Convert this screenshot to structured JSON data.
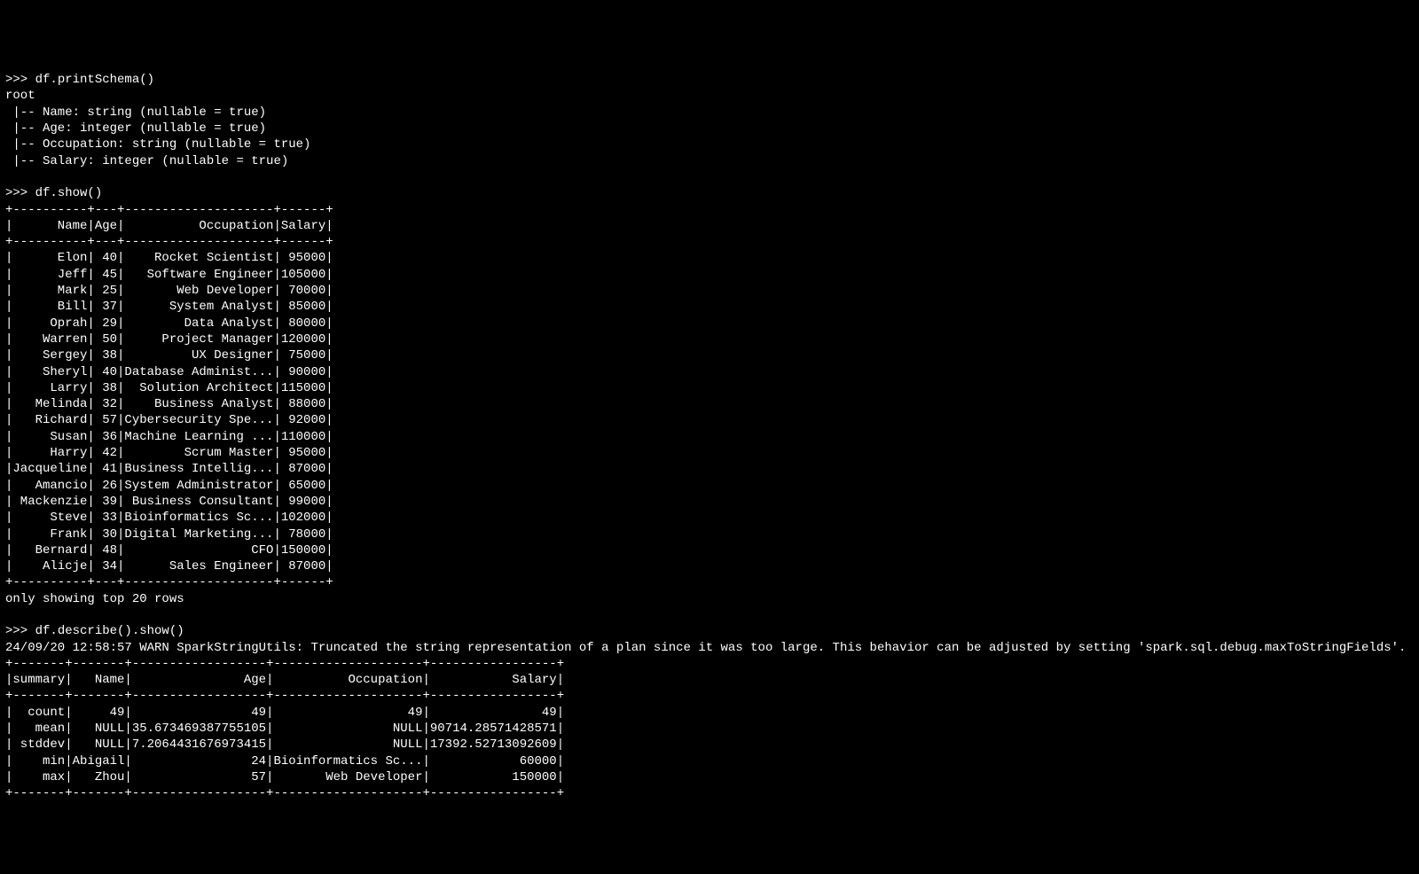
{
  "prompt": ">>> ",
  "commands": {
    "printSchema": "df.printSchema()",
    "show": "df.show()",
    "describe": "df.describe().show()"
  },
  "schema": {
    "root": "root",
    "fields": [
      " |-- Name: string (nullable = true)",
      " |-- Age: integer (nullable = true)",
      " |-- Occupation: string (nullable = true)",
      " |-- Salary: integer (nullable = true)"
    ]
  },
  "showTable": {
    "sep": "+----------+---+--------------------+------+",
    "header": "|      Name|Age|          Occupation|Salary|",
    "rows": [
      "|      Elon| 40|    Rocket Scientist| 95000|",
      "|      Jeff| 45|   Software Engineer|105000|",
      "|      Mark| 25|       Web Developer| 70000|",
      "|      Bill| 37|      System Analyst| 85000|",
      "|     Oprah| 29|        Data Analyst| 80000|",
      "|    Warren| 50|     Project Manager|120000|",
      "|    Sergey| 38|         UX Designer| 75000|",
      "|    Sheryl| 40|Database Administ...| 90000|",
      "|     Larry| 38|  Solution Architect|115000|",
      "|   Melinda| 32|    Business Analyst| 88000|",
      "|   Richard| 57|Cybersecurity Spe...| 92000|",
      "|     Susan| 36|Machine Learning ...|110000|",
      "|     Harry| 42|        Scrum Master| 95000|",
      "|Jacqueline| 41|Business Intellig...| 87000|",
      "|   Amancio| 26|System Administrator| 65000|",
      "| Mackenzie| 39| Business Consultant| 99000|",
      "|     Steve| 33|Bioinformatics Sc...|102000|",
      "|     Frank| 30|Digital Marketing...| 78000|",
      "|   Bernard| 48|                 CFO|150000|",
      "|    Alicje| 34|      Sales Engineer| 87000|"
    ],
    "footer": "only showing top 20 rows"
  },
  "warn": "24/09/20 12:58:57 WARN SparkStringUtils: Truncated the string representation of a plan since it was too large. This behavior can be adjusted by setting 'spark.sql.debug.maxToStringFields'.",
  "describeTable": {
    "sep": "+-------+-------+------------------+--------------------+-----------------+",
    "header": "|summary|   Name|               Age|          Occupation|           Salary|",
    "rows": [
      "|  count|     49|                49|                  49|               49|",
      "|   mean|   NULL|35.673469387755105|                NULL|90714.28571428571|",
      "| stddev|   NULL|7.2064431676973415|                NULL|17392.52713092609|",
      "|    min|Abigail|                24|Bioinformatics Sc...|            60000|",
      "|    max|   Zhou|                57|       Web Developer|           150000|"
    ]
  },
  "chart_data": {
    "type": "table",
    "title": "df.show() — top 20 rows",
    "columns": [
      "Name",
      "Age",
      "Occupation",
      "Salary"
    ],
    "rows": [
      {
        "Name": "Elon",
        "Age": 40,
        "Occupation": "Rocket Scientist",
        "Salary": 95000
      },
      {
        "Name": "Jeff",
        "Age": 45,
        "Occupation": "Software Engineer",
        "Salary": 105000
      },
      {
        "Name": "Mark",
        "Age": 25,
        "Occupation": "Web Developer",
        "Salary": 70000
      },
      {
        "Name": "Bill",
        "Age": 37,
        "Occupation": "System Analyst",
        "Salary": 85000
      },
      {
        "Name": "Oprah",
        "Age": 29,
        "Occupation": "Data Analyst",
        "Salary": 80000
      },
      {
        "Name": "Warren",
        "Age": 50,
        "Occupation": "Project Manager",
        "Salary": 120000
      },
      {
        "Name": "Sergey",
        "Age": 38,
        "Occupation": "UX Designer",
        "Salary": 75000
      },
      {
        "Name": "Sheryl",
        "Age": 40,
        "Occupation": "Database Administ...",
        "Salary": 90000
      },
      {
        "Name": "Larry",
        "Age": 38,
        "Occupation": "Solution Architect",
        "Salary": 115000
      },
      {
        "Name": "Melinda",
        "Age": 32,
        "Occupation": "Business Analyst",
        "Salary": 88000
      },
      {
        "Name": "Richard",
        "Age": 57,
        "Occupation": "Cybersecurity Spe...",
        "Salary": 92000
      },
      {
        "Name": "Susan",
        "Age": 36,
        "Occupation": "Machine Learning ...",
        "Salary": 110000
      },
      {
        "Name": "Harry",
        "Age": 42,
        "Occupation": "Scrum Master",
        "Salary": 95000
      },
      {
        "Name": "Jacqueline",
        "Age": 41,
        "Occupation": "Business Intellig...",
        "Salary": 87000
      },
      {
        "Name": "Amancio",
        "Age": 26,
        "Occupation": "System Administrator",
        "Salary": 65000
      },
      {
        "Name": "Mackenzie",
        "Age": 39,
        "Occupation": "Business Consultant",
        "Salary": 99000
      },
      {
        "Name": "Steve",
        "Age": 33,
        "Occupation": "Bioinformatics Sc...",
        "Salary": 102000
      },
      {
        "Name": "Frank",
        "Age": 30,
        "Occupation": "Digital Marketing...",
        "Salary": 78000
      },
      {
        "Name": "Bernard",
        "Age": 48,
        "Occupation": "CFO",
        "Salary": 150000
      },
      {
        "Name": "Alicje",
        "Age": 34,
        "Occupation": "Sales Engineer",
        "Salary": 87000
      }
    ],
    "describe": {
      "columns": [
        "summary",
        "Name",
        "Age",
        "Occupation",
        "Salary"
      ],
      "rows": [
        {
          "summary": "count",
          "Name": "49",
          "Age": "49",
          "Occupation": "49",
          "Salary": "49"
        },
        {
          "summary": "mean",
          "Name": "NULL",
          "Age": "35.673469387755105",
          "Occupation": "NULL",
          "Salary": "90714.28571428571"
        },
        {
          "summary": "stddev",
          "Name": "NULL",
          "Age": "7.2064431676973415",
          "Occupation": "NULL",
          "Salary": "17392.52713092609"
        },
        {
          "summary": "min",
          "Name": "Abigail",
          "Age": "24",
          "Occupation": "Bioinformatics Sc...",
          "Salary": "60000"
        },
        {
          "summary": "max",
          "Name": "Zhou",
          "Age": "57",
          "Occupation": "Web Developer",
          "Salary": "150000"
        }
      ]
    }
  }
}
